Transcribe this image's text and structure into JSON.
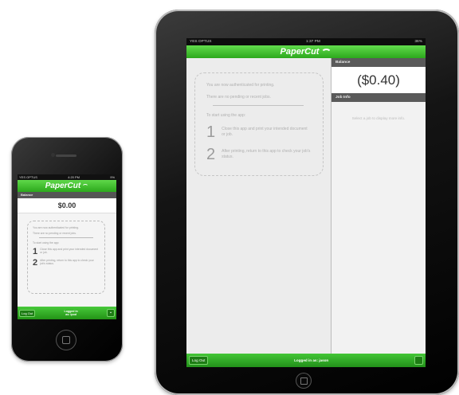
{
  "phone": {
    "status": {
      "carrier": "YES OPTUS",
      "time": "4:20 PM",
      "battery": "9%"
    },
    "brand": "PaperCut",
    "balance_label": "Balance",
    "balance_value": "$0.00",
    "info": {
      "auth_text": "You are now authenticated for printing.",
      "no_jobs_text": "There are no pending or recent jobs.",
      "start_text": "To start using the app:",
      "steps": [
        {
          "num": "1",
          "text": "Close this app and print your intended document or job."
        },
        {
          "num": "2",
          "text": "After printing, return to this app to check your job's status."
        }
      ]
    },
    "footer": {
      "logout_label": "Log Out",
      "logged_in_label": "Logged in",
      "logged_in_user": "as: ipod"
    }
  },
  "ipad": {
    "status": {
      "carrier": "YES OPTUS",
      "time": "1:37 PM",
      "battery": "36%"
    },
    "brand": "PaperCut",
    "info": {
      "auth_text": "You are now authenticated for printing.",
      "no_jobs_text": "There are no pending or recent jobs.",
      "start_text": "To start using the app:",
      "steps": [
        {
          "num": "1",
          "text": "Close this app and print your intended document or job."
        },
        {
          "num": "2",
          "text": "After printing, return to this app to check your job's status."
        }
      ]
    },
    "balance_label": "Balance",
    "balance_value": "($0.40)",
    "job_info_label": "Job Info",
    "job_info_placeholder": "Select a job to display more info.",
    "footer": {
      "logout_label": "Log Out",
      "logged_in_text": "Logged in as: jason"
    }
  },
  "colors": {
    "brand_green": "#2ca81c",
    "header_dark": "#5a5a5a"
  },
  "icons": [
    "wifi-icon",
    "home-button-icon"
  ]
}
